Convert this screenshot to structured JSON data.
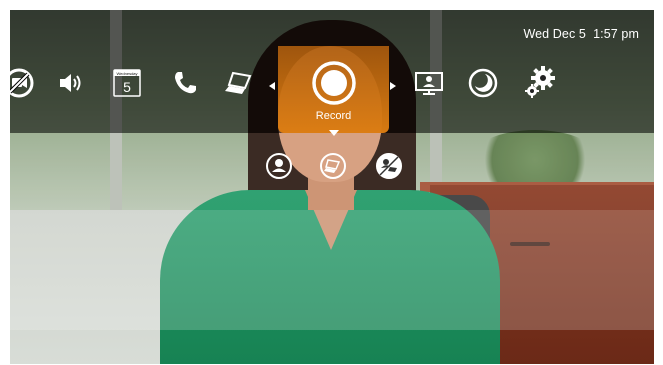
{
  "status_bar": {
    "date": "Wed Dec 5",
    "time": "1:57 pm"
  },
  "calendar_icon": {
    "weekday": "Wednesday",
    "day": "5"
  },
  "menu": {
    "items": [
      {
        "icon": "mute-video-icon"
      },
      {
        "icon": "volume-icon"
      },
      {
        "icon": "calendar-icon"
      },
      {
        "icon": "phone-icon"
      },
      {
        "icon": "laptop-share-icon"
      },
      {
        "icon": "record-icon",
        "label": "Record",
        "selected": true
      },
      {
        "icon": "presenter-icon"
      },
      {
        "icon": "do-not-disturb-icon"
      },
      {
        "icon": "settings-gear-icon"
      }
    ]
  },
  "submenu": {
    "items": [
      {
        "icon": "record-person-icon"
      },
      {
        "icon": "record-content-icon"
      },
      {
        "icon": "record-person-content-icon"
      }
    ]
  },
  "colors": {
    "accent": "#E2800F",
    "overlay": "#000000",
    "text": "#FFFFFF"
  }
}
